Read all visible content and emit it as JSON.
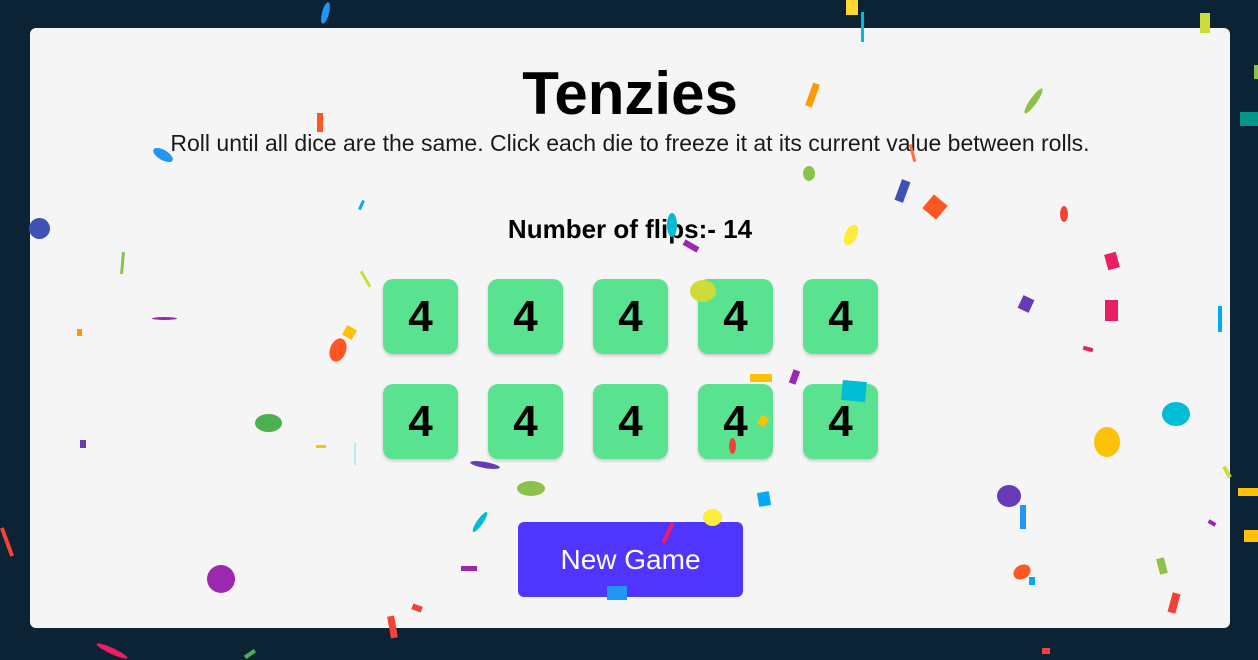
{
  "app": {
    "title": "Tenzies",
    "instructions": "Roll until all dice are the same. Click each die to freeze it at its current value between rolls."
  },
  "flips": {
    "label": "Number of flips:- 14",
    "count": 14
  },
  "dice": [
    {
      "value": "4",
      "held": true
    },
    {
      "value": "4",
      "held": true
    },
    {
      "value": "4",
      "held": true
    },
    {
      "value": "4",
      "held": true
    },
    {
      "value": "4",
      "held": true
    },
    {
      "value": "4",
      "held": true
    },
    {
      "value": "4",
      "held": true
    },
    {
      "value": "4",
      "held": true
    },
    {
      "value": "4",
      "held": true
    },
    {
      "value": "4",
      "held": true
    }
  ],
  "new_game_button": {
    "label": "New Game"
  },
  "colors": {
    "background": "#0b2334",
    "card": "#f5f5f5",
    "held_die": "#59e391",
    "button": "#5035ff"
  }
}
